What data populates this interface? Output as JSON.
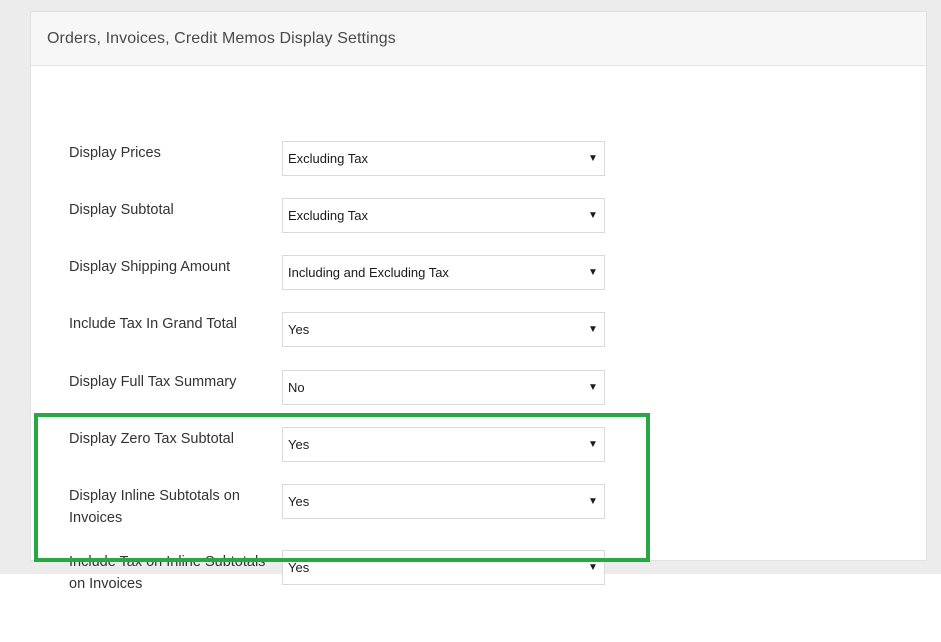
{
  "panel": {
    "title": "Orders, Invoices, Credit Memos Display Settings"
  },
  "settings": [
    {
      "label": "Display Prices",
      "value": "Excluding Tax"
    },
    {
      "label": "Display Subtotal",
      "value": "Excluding Tax"
    },
    {
      "label": "Display Shipping Amount",
      "value": "Including and Excluding Tax"
    },
    {
      "label": "Include Tax In Grand Total",
      "value": "Yes"
    },
    {
      "label": "Display Full Tax Summary",
      "value": "No"
    },
    {
      "label": "Display Zero Tax Subtotal",
      "value": "Yes"
    },
    {
      "label": "Display Inline Subtotals on Invoices",
      "value": "Yes"
    },
    {
      "label": "Include Tax on Inline Subtotals on Invoices",
      "value": "Yes"
    }
  ],
  "highlight": {
    "color": "#27a844"
  },
  "icons": {
    "dropdown": "triangle-down-icon"
  }
}
